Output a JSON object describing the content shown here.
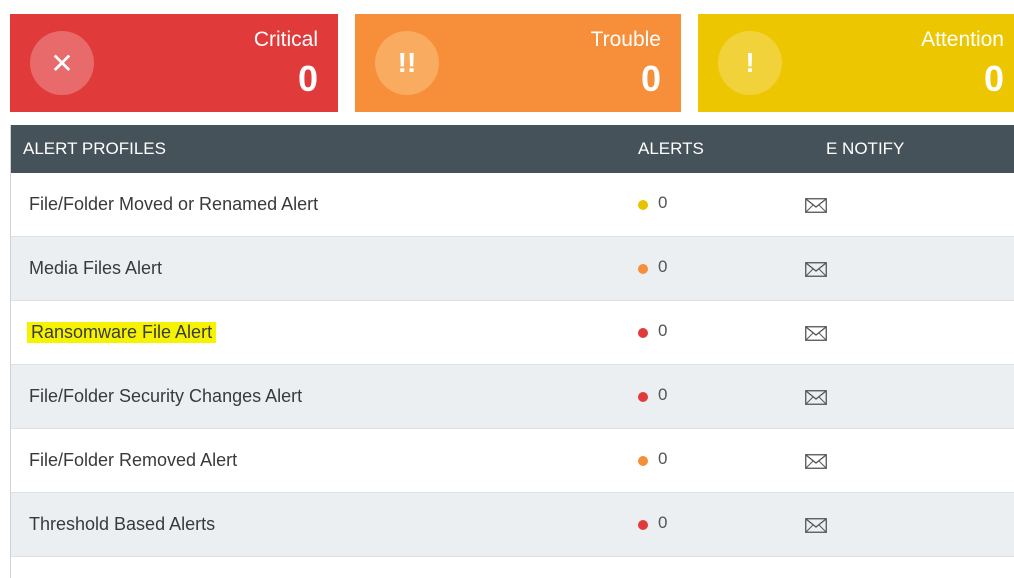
{
  "cards": [
    {
      "id": "critical",
      "label": "Critical",
      "count": "0",
      "icon": "close-icon",
      "icon_glyph": "✕",
      "color": "#e03a3a"
    },
    {
      "id": "trouble",
      "label": "Trouble",
      "count": "0",
      "icon": "double-exclamation-icon",
      "icon_glyph": "!!",
      "color": "#f68e3a"
    },
    {
      "id": "attention",
      "label": "Attention",
      "count": "0",
      "icon": "exclamation-icon",
      "icon_glyph": "!",
      "color": "#ecc600"
    }
  ],
  "table": {
    "headers": {
      "profiles": "ALERT PROFILES",
      "alerts": "ALERTS",
      "notify": "E NOTIFY"
    },
    "rows": [
      {
        "name": "File/Folder Moved or Renamed Alert",
        "severity_color": "#e8c300",
        "alerts": "0",
        "highlighted": false
      },
      {
        "name": "Media Files Alert",
        "severity_color": "#f68e3a",
        "alerts": "0",
        "highlighted": false
      },
      {
        "name": "Ransomware File Alert",
        "severity_color": "#e03a3a",
        "alerts": "0",
        "highlighted": true
      },
      {
        "name": "File/Folder Security Changes Alert",
        "severity_color": "#e03a3a",
        "alerts": "0",
        "highlighted": false
      },
      {
        "name": "File/Folder Removed Alert",
        "severity_color": "#f68e3a",
        "alerts": "0",
        "highlighted": false
      },
      {
        "name": "Threshold Based Alerts",
        "severity_color": "#e03a3a",
        "alerts": "0",
        "highlighted": false
      }
    ]
  }
}
